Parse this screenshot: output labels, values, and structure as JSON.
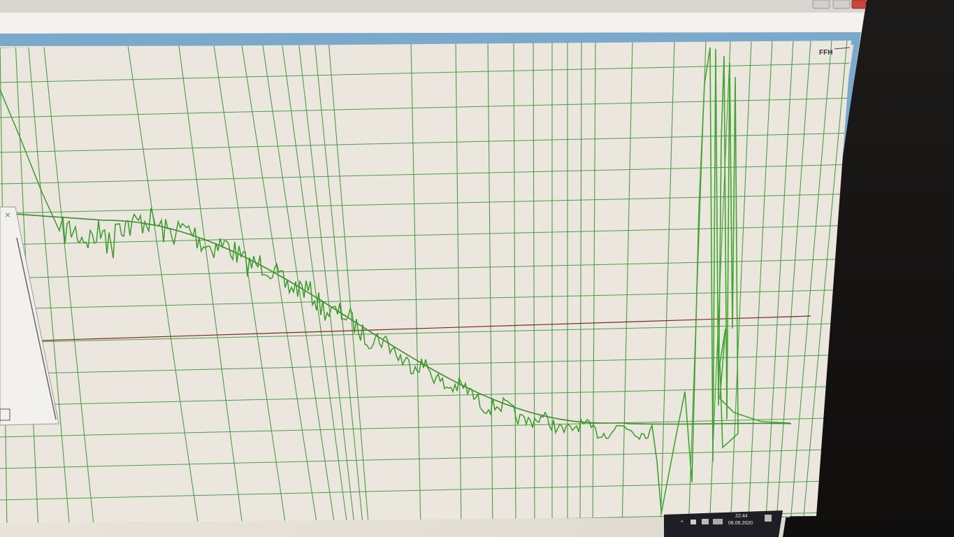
{
  "window": {
    "corner_label": "FFH",
    "close_glyph": "×",
    "titlebar_buttons": [
      "minimize",
      "maximize",
      "close"
    ]
  },
  "taskbar": {
    "time": "22:44",
    "date": "06.06.2020"
  },
  "colors": {
    "grid": "#4f9a48",
    "trace": "#3a9a2a",
    "reference": "#7a2a1a",
    "plot_bg": "#e9e5dc",
    "titlebar_accent": "#6aa7d6"
  }
}
